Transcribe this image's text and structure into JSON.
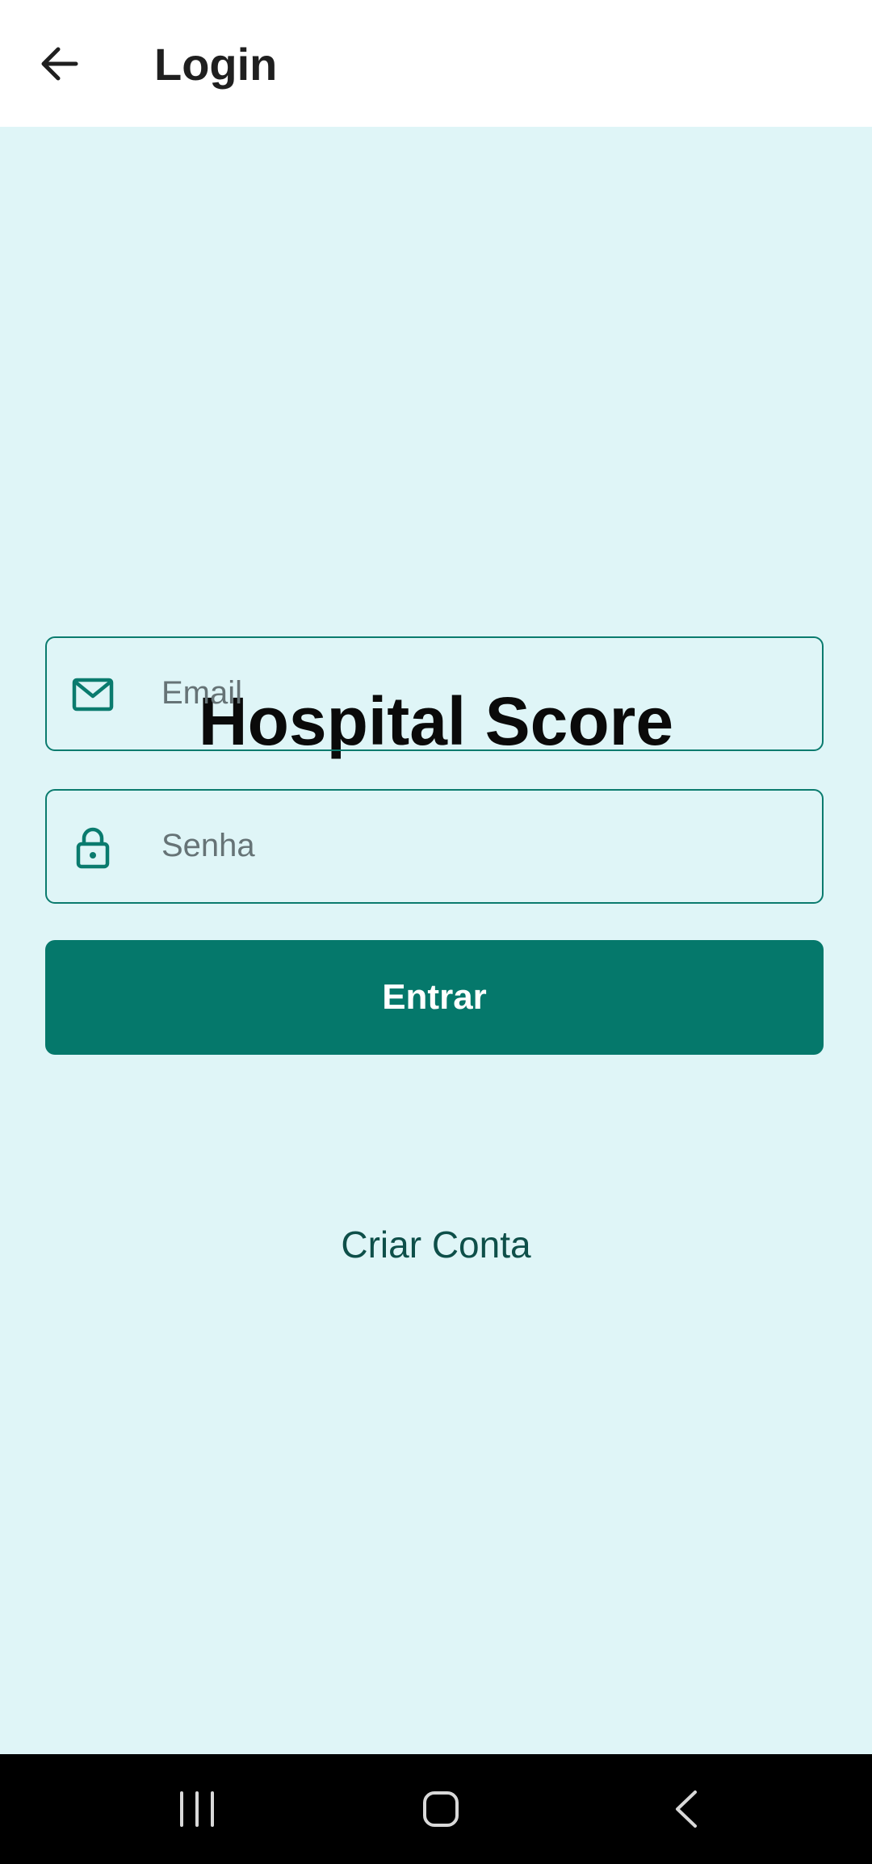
{
  "app_bar": {
    "title": "Login",
    "back_icon": "arrow-left-icon"
  },
  "main": {
    "heading": "Hospital Score",
    "email_field": {
      "placeholder": "Email",
      "icon": "mail-icon"
    },
    "password_field": {
      "placeholder": "Senha",
      "icon": "lock-icon"
    },
    "submit_label": "Entrar",
    "create_account_label": "Criar Conta"
  },
  "nav_bar": {
    "recents_icon": "recents-icon",
    "home_icon": "home-icon",
    "back_icon": "back-chevron-icon"
  },
  "colors": {
    "background": "#dff5f7",
    "accent": "#05786b",
    "app_bar": "#ffffff",
    "nav_bar": "#000000"
  }
}
